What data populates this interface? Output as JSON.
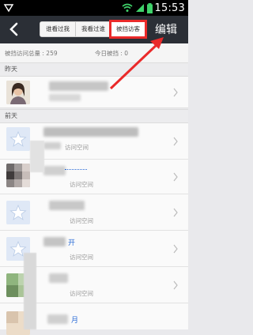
{
  "status_bar": {
    "time": "15:53"
  },
  "nav": {
    "back_icon": "chevron-left-icon",
    "tabs": [
      "谁看过我",
      "我看过谁",
      "被挡访客"
    ],
    "edit_label": "编辑"
  },
  "summary": {
    "total_label": "被挡访问总量 : 259",
    "today_label": "今日被挡 : 0"
  },
  "sections": [
    {
      "title": "昨天"
    },
    {
      "title": "前天"
    }
  ],
  "rows": [
    {
      "sub": ""
    },
    {
      "sub": "访问空间"
    },
    {
      "sub": "访问空间"
    },
    {
      "sub": "访问空间"
    },
    {
      "name_fragment": "开",
      "sub": "访问空间"
    },
    {
      "sub": "访问空间"
    },
    {
      "name_fragment": "月",
      "sub": ""
    }
  ],
  "colors": {
    "highlight": "#ea2a2a",
    "nav_bg": "#2b2f36",
    "accent_link": "#2a6bd6"
  }
}
